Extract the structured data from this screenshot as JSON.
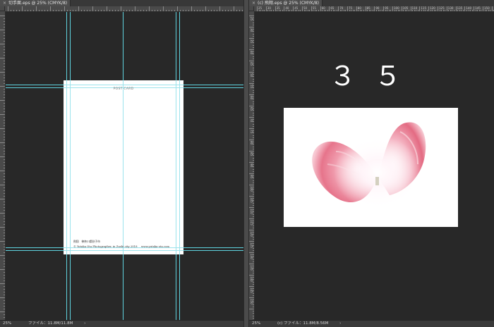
{
  "left_window": {
    "tab_close": "×",
    "tab_title": "切手面.eps @ 25% (CMYK/8)",
    "status_zoom": "25%",
    "status_file": "ファイル：11.8M/11.8M",
    "status_arrow": "›"
  },
  "right_window": {
    "tab_close": "×",
    "tab_title": "(c) 飛翔.eps @ 25% (CMYK/8)",
    "status_zoom": "25%",
    "status_file": "(c) ファイル：11.8M/8.56M",
    "status_arrow": "›",
    "big_number": "３５",
    "ruler_numbers": [
      "25",
      "30",
      "35",
      "40",
      "45",
      "50",
      "55",
      "60",
      "65",
      "70",
      "75",
      "80",
      "85",
      "90",
      "95",
      "100",
      "105",
      "110",
      "115",
      "120",
      "125",
      "130",
      "135",
      "140",
      "145",
      "150"
    ]
  },
  "postcard": {
    "title": "POST CARD",
    "caption": "飛翔　神奈川県秋子市",
    "copyright": "© Yutaka Ota Photographer, in Zushi city 2018",
    "url": "www.yutaka-ota.com"
  },
  "colors": {
    "guide": "#5fd3df",
    "canvas": "#282828",
    "petal": "#e8687f"
  }
}
